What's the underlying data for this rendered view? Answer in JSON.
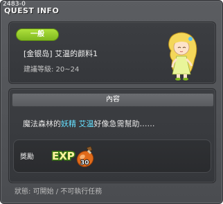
{
  "window": {
    "quest_id": "2483-0",
    "title": "QUEST INFO"
  },
  "info": {
    "category": "一般",
    "quest_name": "[金银岛] 艾温的颜料1",
    "level_requirement": "建議等級: 20~24",
    "npc_icon": "fairy-girl-icon"
  },
  "content": {
    "header": "內容",
    "description": {
      "before": "魔法森林的",
      "highlight1": "妖精",
      "space": " ",
      "highlight2": "艾温",
      "after": "好像急需幫助……"
    },
    "highlight_color": "#66e0ff"
  },
  "reward": {
    "label": "獎勵",
    "icons": [
      "exp-icon",
      "potion-icon"
    ],
    "exp_text": "EXP",
    "item_count": "30"
  },
  "status": {
    "text": "狀態:  可開始 / 不可執行任務"
  }
}
